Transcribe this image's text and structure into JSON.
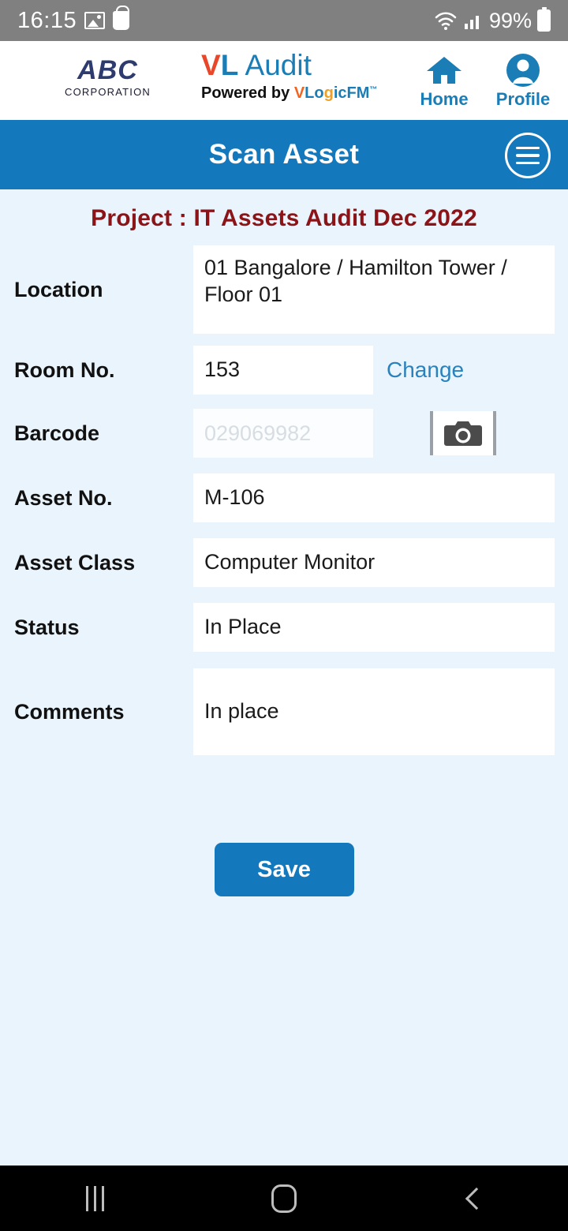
{
  "status_bar": {
    "time": "16:15",
    "battery_percent": "99%",
    "icons": [
      "photo-icon",
      "shopping-bag-icon",
      "wifi-icon",
      "signal-icon",
      "battery-icon"
    ]
  },
  "brand_header": {
    "company_logo_main": "ABC",
    "company_logo_sub": "CORPORATION",
    "app_name_v": "V",
    "app_name_l": "L",
    "app_name_rest": " Audit",
    "powered_by_text": "Powered by",
    "powered_brand_v": "V",
    "powered_brand_lo": "Lo",
    "powered_brand_g": "g",
    "powered_brand_icfm": "icFM",
    "powered_brand_tm": "™",
    "nav": [
      {
        "label": "Home",
        "icon": "home-icon"
      },
      {
        "label": "Profile",
        "icon": "profile-icon"
      }
    ],
    "accent_blue": "#1a7db5"
  },
  "title_bar": {
    "title": "Scan Asset",
    "menu_icon": "hamburger-menu-icon",
    "background": "#1478bd"
  },
  "project": {
    "heading": "Project : IT Assets  Audit Dec 2022",
    "color": "#8b1418"
  },
  "form": {
    "location": {
      "label": "Location",
      "value": "01 Bangalore / Hamilton Tower / Floor 01"
    },
    "room_no": {
      "label": "Room No.",
      "value": "153",
      "change_link": "Change"
    },
    "barcode": {
      "label": "Barcode",
      "placeholder": "029069982",
      "value": "",
      "camera_icon": "camera-icon"
    },
    "asset_no": {
      "label": "Asset No.",
      "value": "M-106"
    },
    "asset_class": {
      "label": "Asset Class",
      "value": "Computer Monitor"
    },
    "status": {
      "label": "Status",
      "value": "In Place"
    },
    "comments": {
      "label": "Comments",
      "value": "In place"
    },
    "save_button": "Save"
  },
  "nav_bar": {
    "recents": "recents-icon",
    "home": "home-square-icon",
    "back": "back-chevron-icon"
  }
}
